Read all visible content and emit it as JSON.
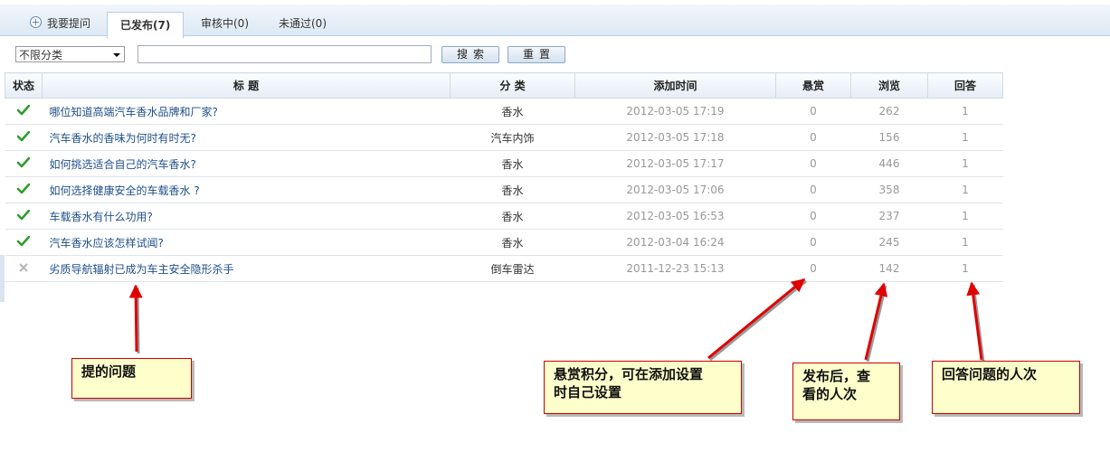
{
  "tabs": {
    "ask": "我要提问",
    "published": "已发布(7)",
    "reviewing": "审核中(0)",
    "rejected": "未通过(0)"
  },
  "search": {
    "category_select": "不限分类",
    "keyword_value": "",
    "search_label": "搜索",
    "reset_label": "重置"
  },
  "table": {
    "headers": {
      "status": "状态",
      "title": "标 题",
      "category": "分 类",
      "time": "添加时间",
      "reward": "悬赏",
      "views": "浏览",
      "answers": "回答"
    },
    "rows": [
      {
        "status": "approved",
        "title": "哪位知道高端汽车香水品牌和厂家?",
        "category": "香水",
        "time": "2012-03-05 17:19",
        "reward": "0",
        "views": "262",
        "answers": "1"
      },
      {
        "status": "approved",
        "title": "汽车香水的香味为何时有时无?",
        "category": "汽车内饰",
        "time": "2012-03-05 17:18",
        "reward": "0",
        "views": "156",
        "answers": "1"
      },
      {
        "status": "approved",
        "title": "如何挑选适合自己的汽车香水?",
        "category": "香水",
        "time": "2012-03-05 17:17",
        "reward": "0",
        "views": "446",
        "answers": "1"
      },
      {
        "status": "approved",
        "title": "如何选择健康安全的车载香水 ?",
        "category": "香水",
        "time": "2012-03-05 17:06",
        "reward": "0",
        "views": "358",
        "answers": "1"
      },
      {
        "status": "approved",
        "title": "车载香水有什么功用?",
        "category": "香水",
        "time": "2012-03-05 16:53",
        "reward": "0",
        "views": "237",
        "answers": "1"
      },
      {
        "status": "approved",
        "title": "汽车香水应该怎样试闻?",
        "category": "香水",
        "time": "2012-03-04 16:24",
        "reward": "0",
        "views": "245",
        "answers": "1"
      },
      {
        "status": "rejected",
        "title": "劣质导航辐射已成为车主安全隐形杀手",
        "category": "倒车雷达",
        "time": "2011-12-23 15:13",
        "reward": "0",
        "views": "142",
        "answers": "1"
      }
    ]
  },
  "annotations": {
    "question": "提的问题",
    "reward_line1": "悬赏积分，可在添加设置",
    "reward_line2": "时自己设置",
    "views_line1": "发布后，查",
    "views_line2": "看的人次",
    "answers": "回答问题的人次"
  },
  "colors": {
    "approved": "#2e9e2e",
    "rejected": "#b5b5b5",
    "arrow": "#e00000",
    "link": "#1e4f8a"
  },
  "icons": {
    "ask_tab": "plus-circle-icon",
    "approved": "check-icon",
    "rejected": "x-icon",
    "select": "chevron-down-icon"
  }
}
